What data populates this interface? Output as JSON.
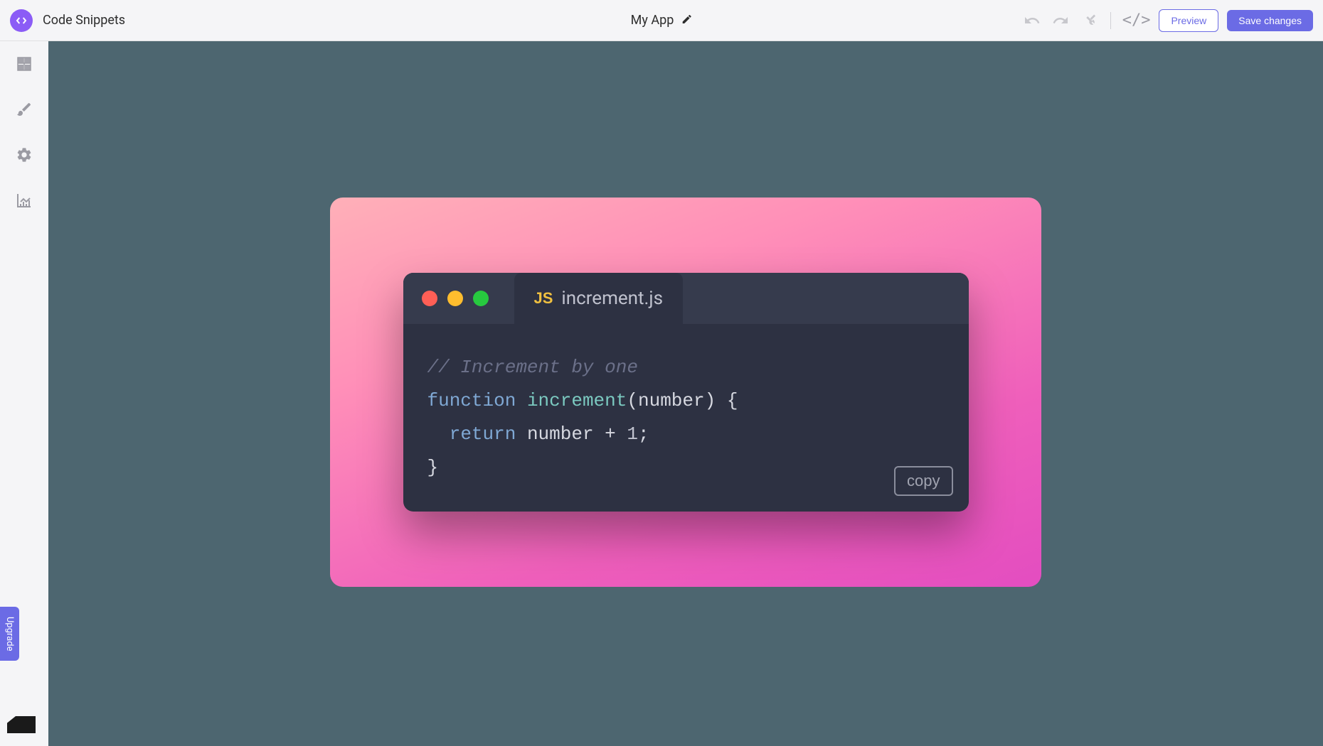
{
  "header": {
    "title": "Code Snippets",
    "app_name": "My App",
    "preview_label": "Preview",
    "save_label": "Save changes"
  },
  "sidebar": {
    "upgrade_label": "Upgrade"
  },
  "snippet": {
    "filename": "increment.js",
    "js_badge": "JS",
    "copy_label": "copy",
    "code": {
      "line1_comment": "// Increment by one",
      "line2_keyword": "function",
      "line2_name": "increment",
      "line2_params_open": "(",
      "line2_params": "number",
      "line2_params_close": ") {",
      "line3_keyword": "return",
      "line3_expr_a": " number + ",
      "line3_num": "1",
      "line3_semi": ";",
      "line4_close": "}"
    }
  }
}
